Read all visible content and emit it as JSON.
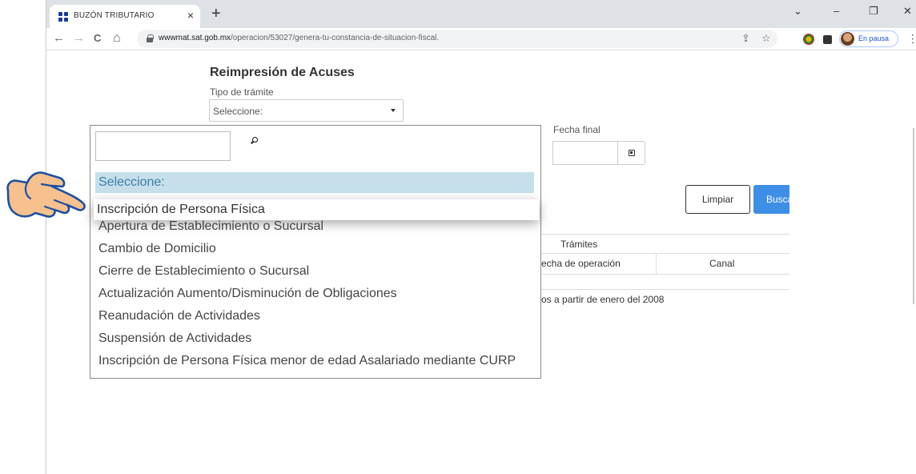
{
  "browser": {
    "tab_title": "BUZÓN TRIBUTARIO",
    "tab_close": "×",
    "new_tab": "+",
    "url_domain": "wwwmat.sat.gob.mx",
    "url_path": "/operacion/53027/genera-tu-constancia-de-situacion-fiscal.",
    "profile_label": "En pausa",
    "nav": {
      "back": "←",
      "forward": "→",
      "reload": "C",
      "home": "⌂"
    },
    "window_controls": {
      "chevron": "⌄",
      "minimize": "–",
      "restore": "❐",
      "close": "✕"
    },
    "menu": "⋮",
    "share": "⇪",
    "bookmark": "☆"
  },
  "page": {
    "title": "Reimpresión de Acuses",
    "tipo_label": "Tipo de trámite",
    "select_value": "Seleccione:",
    "fecha_final_label": "Fecha final",
    "btn_limpiar": "Limpiar",
    "btn_buscar": "Buscar",
    "table": {
      "group_header": "Trámites",
      "col_fecha": "echa de operación",
      "col_canal": "Canal",
      "note": "os a partir de enero del 2008"
    }
  },
  "dropdown": {
    "search_value": "",
    "selected_option": "Seleccione:",
    "hovered_option": "Inscripción de Persona Física",
    "options": [
      "Apertura de Establecimiento o Sucursal",
      "Cambio de Domicilio",
      "Cierre de Establecimiento o Sucursal",
      "Actualización Aumento/Disminución de Obligaciones",
      "Reanudación de Actividades",
      "Suspensión de Actividades",
      "Inscripción de Persona Física menor de edad Asalariado mediante CURP"
    ]
  },
  "colors": {
    "accent_blue": "#3f8ee6",
    "selected_bg": "#c6dfeb",
    "selected_text": "#3a7fa8"
  },
  "icons": [
    "sat-favicon-icon",
    "lock-icon",
    "search-icon",
    "calendar-icon",
    "hand-pointer-icon",
    "extension-icon",
    "puzzle-icon"
  ]
}
